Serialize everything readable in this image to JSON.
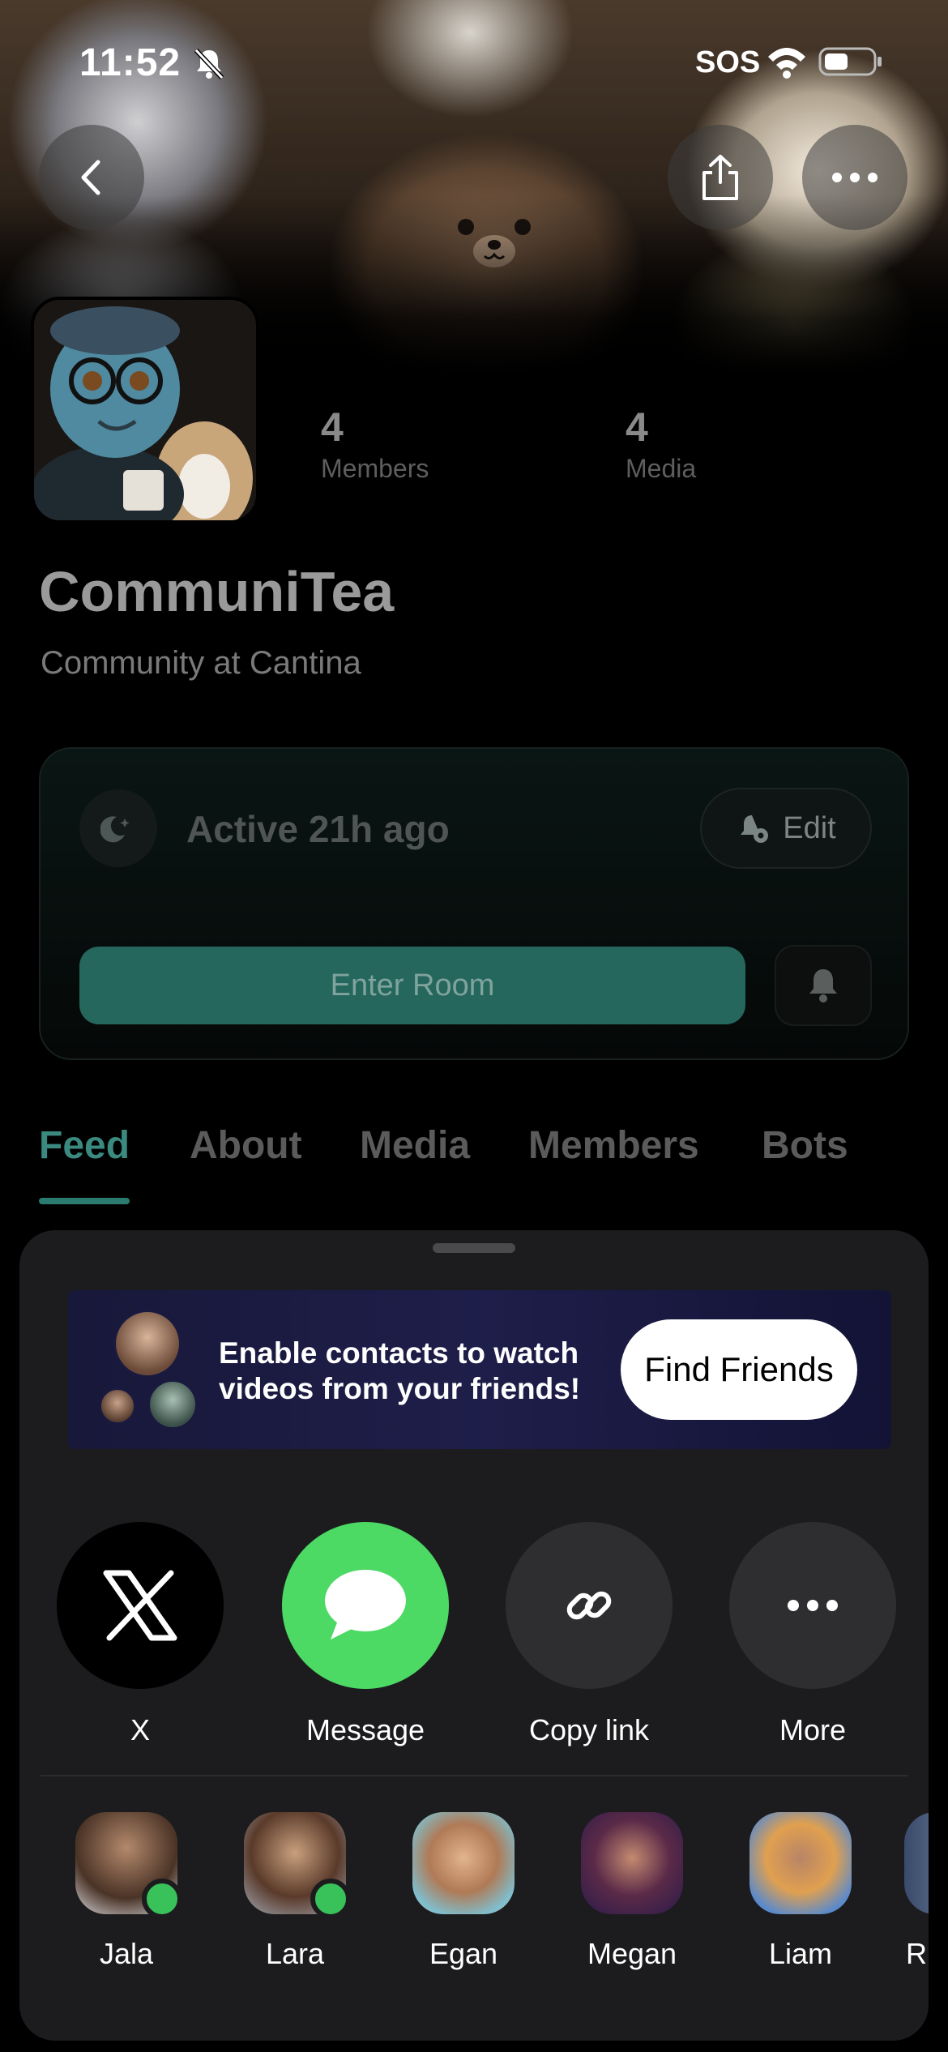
{
  "status_bar": {
    "time": "11:52",
    "carrier": "SOS"
  },
  "header": {
    "back_icon": "chevron-left-icon",
    "share_icon": "share-icon",
    "more_icon": "ellipsis-icon"
  },
  "profile": {
    "name": "CommuniTea",
    "subtitle": "Community at Cantina",
    "stats": [
      {
        "value": "4",
        "label": "Members"
      },
      {
        "value": "4",
        "label": "Media"
      }
    ]
  },
  "room_card": {
    "status": "Active 21h ago",
    "edit_label": "Edit",
    "enter_label": "Enter Room"
  },
  "tabs": [
    {
      "label": "Feed",
      "active": true
    },
    {
      "label": "About",
      "active": false
    },
    {
      "label": "Media",
      "active": false
    },
    {
      "label": "Members",
      "active": false
    },
    {
      "label": "Bots",
      "active": false
    }
  ],
  "share_sheet": {
    "promo_line1": "Enable contacts to watch",
    "promo_line2": "videos from your friends!",
    "find_friends_label": "Find Friends",
    "apps": [
      {
        "label": "X",
        "icon": "x-logo-icon"
      },
      {
        "label": "Message",
        "icon": "message-bubble-icon"
      },
      {
        "label": "Copy link",
        "icon": "link-icon"
      },
      {
        "label": "More",
        "icon": "ellipsis-icon"
      }
    ],
    "contacts": [
      {
        "name": "Jala",
        "online": true
      },
      {
        "name": "Lara",
        "online": true
      },
      {
        "name": "Egan",
        "online": false
      },
      {
        "name": "Megan",
        "online": false
      },
      {
        "name": "Liam",
        "online": false
      },
      {
        "name": "R",
        "online": false
      }
    ]
  },
  "colors": {
    "accent": "#2c7b70",
    "enter_button": "#25665d",
    "message_green": "#4cd964",
    "online_green": "#39c25a"
  }
}
